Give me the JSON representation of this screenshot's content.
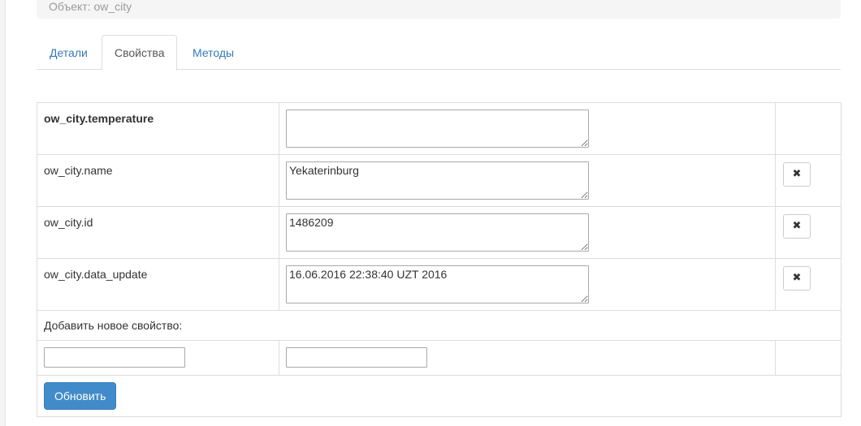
{
  "object_bar": {
    "text": "Объект: ow_city"
  },
  "tabs": [
    {
      "label": "Детали",
      "active": false
    },
    {
      "label": "Свойства",
      "active": true
    },
    {
      "label": "Методы",
      "active": false
    }
  ],
  "properties": [
    {
      "name": "ow_city.temperature",
      "value": "",
      "bold": true,
      "deletable": false
    },
    {
      "name": "ow_city.name",
      "value": "Yekaterinburg",
      "bold": false,
      "deletable": true
    },
    {
      "name": "ow_city.id",
      "value": "1486209",
      "bold": false,
      "deletable": true
    },
    {
      "name": "ow_city.data_update",
      "value": "16.06.2016 22:38:40 UZT 2016",
      "bold": false,
      "deletable": true
    }
  ],
  "delete_icon": "✖",
  "add_property": {
    "label": "Добавить новое свойство:",
    "name_value": "",
    "value_value": ""
  },
  "update_button": {
    "label": "Обновить"
  },
  "colors": {
    "link": "#337ab7",
    "primary": "#428bca"
  }
}
